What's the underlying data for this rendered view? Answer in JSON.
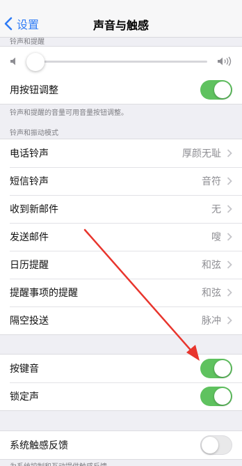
{
  "nav": {
    "back_label": "设置",
    "title": "声音与触感"
  },
  "ringer_section": {
    "header": "铃声和提醒",
    "slider_level": 0.03,
    "adjust_with_buttons_label": "用按钮调整",
    "adjust_with_buttons_on": true,
    "footer": "铃声和提醒的音量可用音量按钮调整。"
  },
  "patterns_section": {
    "header": "铃声和振动模式",
    "items": [
      {
        "label": "电话铃声",
        "value": "厚颜无耻"
      },
      {
        "label": "短信铃声",
        "value": "音符"
      },
      {
        "label": "收到新邮件",
        "value": "无"
      },
      {
        "label": "发送邮件",
        "value": "嗖"
      },
      {
        "label": "日历提醒",
        "value": "和弦"
      },
      {
        "label": "提醒事项的提醒",
        "value": "和弦"
      },
      {
        "label": "隔空投送",
        "value": "脉冲"
      }
    ]
  },
  "clicks_section": {
    "keyboard_clicks_label": "按键音",
    "keyboard_clicks_on": true,
    "lock_sound_label": "锁定声",
    "lock_sound_on": true
  },
  "haptics_section": {
    "system_haptics_label": "系统触感反馈",
    "system_haptics_on": false,
    "footer": "为系统控制和互动提供触感反馈。"
  },
  "colors": {
    "accent": "#2f7cf6",
    "toggle_on": "#5fc25f",
    "annotation_arrow": "#e8352d"
  }
}
